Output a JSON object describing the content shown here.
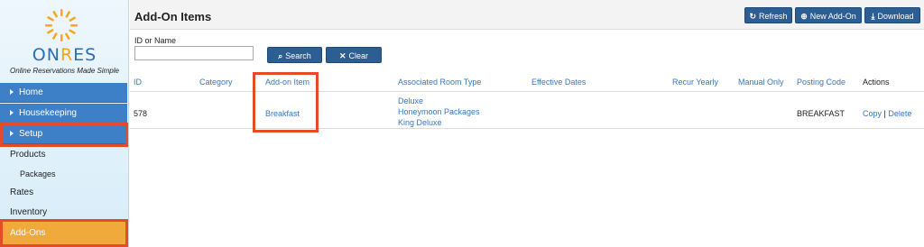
{
  "brand": {
    "logo_text_on": "ON",
    "logo_text_r": "R",
    "logo_text_es": "ES",
    "tagline": "Online Reservations Made Simple"
  },
  "sidebar": {
    "items": [
      {
        "label": "Home"
      },
      {
        "label": "Housekeeping"
      },
      {
        "label": "Setup"
      },
      {
        "label": "Products"
      },
      {
        "label": "Packages"
      },
      {
        "label": "Rates"
      },
      {
        "label": "Inventory"
      },
      {
        "label": "Add-Ons"
      }
    ]
  },
  "header": {
    "title": "Add-On Items",
    "refresh_label": "Refresh",
    "new_label": "New Add-On",
    "download_label": "Download"
  },
  "filter": {
    "label": "ID or Name",
    "value": "",
    "search_label": "Search",
    "clear_label": "Clear"
  },
  "table": {
    "columns": [
      "ID",
      "Category",
      "Add-on Item",
      "Associated Room Type",
      "Effective Dates",
      "Recur Yearly",
      "Manual Only",
      "Posting Code",
      "Actions"
    ],
    "rows": [
      {
        "id": "578",
        "category": "",
        "item": "Breakfast",
        "rooms": [
          "Deluxe",
          "Honeymoon Packages",
          "King Deluxe"
        ],
        "effective_dates": "",
        "recur_yearly": "",
        "manual_only": "",
        "posting_code": "BREAKFAST",
        "copy_label": "Copy",
        "separator": "|",
        "delete_label": "Delete"
      }
    ]
  },
  "colors": {
    "nav_blue": "#3d80c7",
    "active_orange": "#f0a93a",
    "button_blue": "#2c5d93",
    "link_blue": "#3a78c0",
    "highlight_red": "#e64a2b"
  }
}
